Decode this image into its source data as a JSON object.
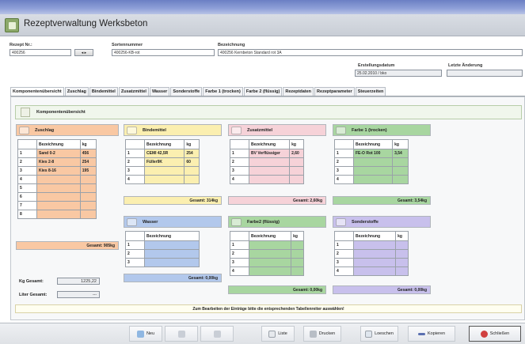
{
  "window": {
    "title": "Rezeptverwaltung Werksbeton"
  },
  "header": {
    "rezept_nr_label": "Rezept Nr.:",
    "rezept_nr_value": "400256",
    "sortennummer_label": "Sortennummer",
    "sortennummer_value": "400256-KB-rot",
    "bezeichnung_label": "Bezeichnung",
    "bezeichnung_value": "400256 Kernbeton Standard rot 3A",
    "erstellungsdatum_label": "Erstellungsdatum",
    "erstellungsdatum_value": "25.02.2010 / bko",
    "letzte_aenderung_label": "Letzte Änderung",
    "letzte_aenderung_value": ""
  },
  "tabs": [
    "Komponentenübersicht",
    "Zuschlag",
    "Bindemittel",
    "Zusatzmittel",
    "Wasser",
    "Sonderstoffe",
    "Farbe 1 (trocken)",
    "Farbe 2 (flüssig)",
    "Rezeptdaten",
    "Rezeptparameter",
    "Steuerzeiten"
  ],
  "overview_label": "Komponentenübersicht",
  "col_bez": "Bezeichnung",
  "col_kg": "kg",
  "cards": {
    "zuschlag": {
      "title": "Zuschlag",
      "rows": [
        [
          "1",
          "Sand 0-2",
          "456"
        ],
        [
          "2",
          "Kies 2-8",
          "254"
        ],
        [
          "3",
          "Kies 8-16",
          "195"
        ],
        [
          "4",
          "",
          ""
        ],
        [
          "5",
          "",
          ""
        ],
        [
          "6",
          "",
          ""
        ],
        [
          "7",
          "",
          ""
        ],
        [
          "8",
          "",
          ""
        ]
      ],
      "total": "Gesamt: 905kg",
      "color": "#f9c8a3"
    },
    "bindemittel": {
      "title": "Bindemittel",
      "rows": [
        [
          "1",
          "CEMI 42,5R",
          "254"
        ],
        [
          "2",
          "Füller9K",
          "60"
        ],
        [
          "3",
          "",
          ""
        ],
        [
          "4",
          "",
          ""
        ]
      ],
      "total": "Gesamt: 314kg",
      "color": "#fbefb0"
    },
    "zusatzmittel": {
      "title": "Zusatzmittel",
      "rows": [
        [
          "1",
          "BV Verflüssiger",
          "2,60"
        ],
        [
          "2",
          "",
          ""
        ],
        [
          "3",
          "",
          ""
        ],
        [
          "4",
          "",
          ""
        ]
      ],
      "total": "Gesamt: 2,60kg",
      "color": "#f6d2d8"
    },
    "farbe1": {
      "title": "Farbe 1 (trocken)",
      "rows": [
        [
          "1",
          "FE-O Rot 100",
          "3,54"
        ],
        [
          "2",
          "",
          ""
        ],
        [
          "3",
          "",
          ""
        ],
        [
          "4",
          "",
          ""
        ]
      ],
      "total": "Gesamt: 3,54kg",
      "color": "#a8d6a0"
    },
    "wasser": {
      "title": "Wasser",
      "rows": [
        [
          "1",
          ""
        ],
        [
          "2",
          ""
        ],
        [
          "3",
          ""
        ]
      ],
      "total": "Gesamt: 0,00kg",
      "color": "#b2c8ec"
    },
    "farbe2": {
      "title": "Farbe2 (flüssig)",
      "rows": [
        [
          "1",
          "",
          ""
        ],
        [
          "2",
          "",
          ""
        ],
        [
          "3",
          "",
          ""
        ],
        [
          "4",
          "",
          ""
        ]
      ],
      "total": "Gesamt: 0,00kg",
      "color": "#a8d6a0"
    },
    "sonderstoffe": {
      "title": "Sonderstoffe",
      "rows": [
        [
          "1",
          "",
          ""
        ],
        [
          "2",
          "",
          ""
        ],
        [
          "3",
          "",
          ""
        ],
        [
          "4",
          "",
          ""
        ]
      ],
      "total": "Gesamt: 0,00kg",
      "color": "#c8c0ec"
    }
  },
  "kg_gesamt_label": "Kg Gesamt:",
  "kg_gesamt_value": "1225,22",
  "liter_gesamt_label": "Liter Gesamt:",
  "liter_gesamt_value": "---",
  "hint": "Zum Bearbeiten der Einträge bitte die entsprechenden Tabellenreiter auswählen!",
  "toolbar": {
    "neu": "Neu",
    "liste": "Liste",
    "drucken": "Drucken",
    "loeschen": "Loeschen",
    "kopieren": "Kopieren",
    "schliessen": "Schließen"
  }
}
